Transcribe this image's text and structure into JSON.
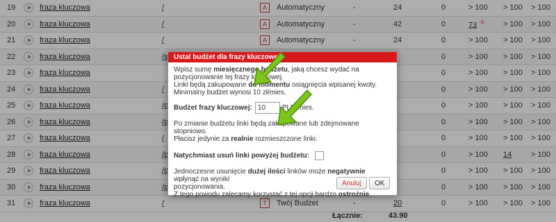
{
  "rows": [
    {
      "num": "19",
      "phrase": "fraza kluczowa",
      "link": "/",
      "badge": "A",
      "type": "Automatyczny",
      "dash": "-",
      "pos": "24",
      "zero": "0",
      "v1": "> 100",
      "v1_delta": "",
      "v2": "> 100",
      "v3": "> 100"
    },
    {
      "num": "20",
      "phrase": "fraza kluczowa",
      "link": "/",
      "badge": "A",
      "type": "Automatyczny",
      "dash": "-",
      "pos": "42",
      "zero": "0",
      "v1": "73",
      "v1_delta": "-6",
      "v2": "> 100",
      "v3": "> 100"
    },
    {
      "num": "21",
      "phrase": "fraza kluczowa",
      "link": "/",
      "badge": "A",
      "type": "Automatyczny",
      "dash": "-",
      "pos": "24",
      "zero": "0",
      "v1": "> 100",
      "v1_delta": "",
      "v2": "> 100",
      "v3": "> 100"
    },
    {
      "num": "22",
      "phrase": "fraza kluczowa",
      "link": "/s",
      "badge": "",
      "type": "",
      "dash": "",
      "pos": "",
      "zero": "0",
      "v1": "> 100",
      "v1_delta": "",
      "v2": "> 100",
      "v3": "> 100"
    },
    {
      "num": "23",
      "phrase": "fraza kluczowa",
      "link": "",
      "badge": "",
      "type": "",
      "dash": "",
      "pos": "",
      "zero": "0",
      "v1": "> 100",
      "v1_delta": "",
      "v2": "> 100",
      "v3": "> 100"
    },
    {
      "num": "24",
      "phrase": "fraza kluczowa",
      "link": "/",
      "badge": "",
      "type": "",
      "dash": "",
      "pos": "",
      "zero": "0",
      "v1": "> 100",
      "v1_delta": "",
      "v2": "> 100",
      "v3": "> 100"
    },
    {
      "num": "25",
      "phrase": "fraza kluczowa",
      "link": "/p",
      "badge": "",
      "type": "",
      "dash": "",
      "pos": "",
      "zero": "0",
      "v1": "> 100",
      "v1_delta": "",
      "v2": "> 100",
      "v3": "> 100"
    },
    {
      "num": "26",
      "phrase": "fraza kluczowa",
      "link": "/p",
      "badge": "",
      "type": "",
      "dash": "",
      "pos": "",
      "zero": "0",
      "v1": "> 100",
      "v1_delta": "",
      "v2": "> 100",
      "v3": "> 100"
    },
    {
      "num": "27",
      "phrase": "fraza kluczowa",
      "link": "/",
      "badge": "",
      "type": "",
      "dash": "",
      "pos": "",
      "zero": "0",
      "v1": "> 100",
      "v1_delta": "",
      "v2": "> 100",
      "v3": "> 100"
    },
    {
      "num": "28",
      "phrase": "fraza kluczowa",
      "link": "/p",
      "badge": "",
      "type": "",
      "dash": "",
      "pos": "",
      "zero": "0",
      "v1": "> 100",
      "v1_delta": "",
      "v2": "14",
      "v3": "> 100"
    },
    {
      "num": "29",
      "phrase": "fraza kluczowa",
      "link": "/p",
      "badge": "",
      "type": "",
      "dash": "",
      "pos": "",
      "zero": "0",
      "v1": "> 100",
      "v1_delta": "",
      "v2": "> 100",
      "v3": "> 100"
    },
    {
      "num": "30",
      "phrase": "fraza kluczowa",
      "link": "/p",
      "badge": "",
      "type": "",
      "dash": "",
      "pos": "",
      "zero": "0",
      "v1": "> 100",
      "v1_delta": "",
      "v2": "> 100",
      "v3": "> 100"
    },
    {
      "num": "31",
      "phrase": "fraza kluczowa",
      "link": "/",
      "badge": "T",
      "type": "Twój Budżet",
      "dash": "-",
      "pos": "20",
      "zero": "0",
      "v1": "> 100",
      "v1_delta": "",
      "v2": "> 100",
      "v3": "> 100"
    }
  ],
  "total": {
    "label": "Łącznie:",
    "value": "43.90"
  },
  "modal": {
    "title": "Ustal budżet dla frazy kluczowej",
    "intro_1a": "Wpisz sumę ",
    "intro_1b": "miesięcznego budżetu",
    "intro_1c": ", jaką chcesz wydać na pozycjonowanie tej frazy kluczowej.",
    "intro_2a": "Linki będą zakupowane ",
    "intro_2b": "do momentu",
    "intro_2c": " osiągnięcia wpisanej kwoty.",
    "intro_3": "Minimalny budżet wynosi 10 zł/mies.",
    "budget_label": "Budżet frazy kluczowej:",
    "budget_value": "10",
    "budget_unit": "PLN/mies.",
    "change_1": "Po zmianie budżetu linki będą zakupowane lub zdejmowane stopniowo.",
    "change_2a": "Płacisz jedynie za ",
    "change_2b": "realnie",
    "change_2c": " rozmieszczone linki.",
    "remove_label": "Natychmiast usuń linki powyżej budżetu:",
    "warn_1a": "Jednoczesne usunięcie ",
    "warn_1b": "dużej ilości",
    "warn_1c": " linków może ",
    "warn_1d": "negatywnie",
    "warn_1e": " wpłynąć na wyniki",
    "warn_2": "pozycjonowania.",
    "warn_3a": "Z tego powodu zalecamy korzystać z tej opcji bardzo ",
    "warn_3b": "ostrożnie",
    "warn_3c": ".",
    "cancel_label": "Anuluj",
    "ok_label": "OK"
  },
  "colors": {
    "header": "#d7191c",
    "arrow": "#7cc619",
    "delta": "#dd3333"
  }
}
